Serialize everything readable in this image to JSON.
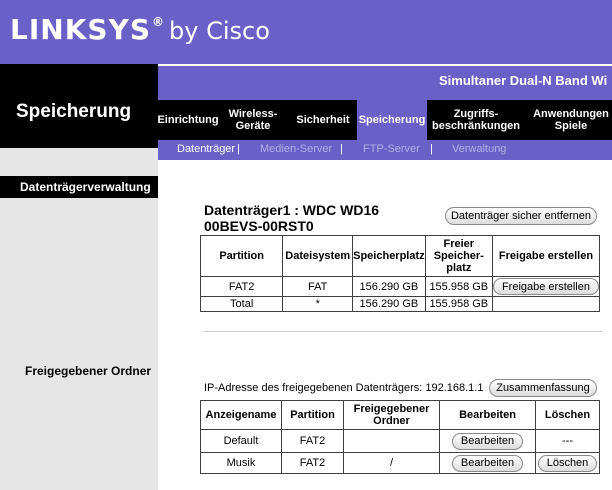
{
  "brand": {
    "logo": "LINKSYS",
    "reg": "®",
    "by": "by Cisco"
  },
  "section_title": "Speicherung",
  "product_name": "Simultaner Dual-N Band Wi",
  "tabs": [
    {
      "label": "Einrichtung",
      "active": false
    },
    {
      "label": "Wireless-Geräte",
      "active": false
    },
    {
      "label": "Sicherheit",
      "active": false
    },
    {
      "label": "Speicherung",
      "active": true
    },
    {
      "label": "Zugriffs-beschränkungen",
      "active": false
    },
    {
      "label": "Anwendungen Spiele",
      "active": false
    }
  ],
  "subtabs": [
    {
      "label": "Datenträger",
      "active": true
    },
    {
      "label": "Medien-Server",
      "active": false
    },
    {
      "label": "FTP-Server",
      "active": false
    },
    {
      "label": "Verwaltung",
      "active": false
    }
  ],
  "subtab_separator": "|",
  "sidebar": {
    "heading": "Datenträgerverwaltung",
    "shared_folder_label": "Freigegebener Ordner"
  },
  "disk": {
    "title": "Datenträger1 : WDC WD16 00BEVS-00RST0",
    "remove_button": "Datenträger sicher entfernen",
    "headers": [
      "Partition",
      "Dateisystem",
      "Speicherplatz",
      "Freier Speicher-platz",
      "Freigabe erstellen"
    ],
    "rows": [
      {
        "partition": "FAT2",
        "fs": "FAT",
        "space": "156.290 GB",
        "free": "155.958 GB",
        "action": "Freigabe erstellen"
      },
      {
        "partition": "Total",
        "fs": "*",
        "space": "156.290 GB",
        "free": "155.958 GB",
        "action": ""
      }
    ]
  },
  "shares": {
    "ip_text": "IP-Adresse des freigegebenen Datenträgers: 192.168.1.1",
    "summary_button": "Zusammenfassung",
    "headers": [
      "Anzeigename",
      "Partition",
      "Freigegebener Ordner",
      "Bearbeiten",
      "Löschen"
    ],
    "rows": [
      {
        "name": "Default",
        "partition": "FAT2",
        "folder": "",
        "edit": "Bearbeiten",
        "delete": "---"
      },
      {
        "name": "Musik",
        "partition": "FAT2",
        "folder": "/",
        "edit": "Bearbeiten",
        "delete": "Löschen"
      }
    ]
  },
  "colors": {
    "brand_purple": "#6b60c8",
    "black": "#000000",
    "sidebar_gray": "#e6e6e6",
    "inactive_subtab": "#b4aee6"
  }
}
